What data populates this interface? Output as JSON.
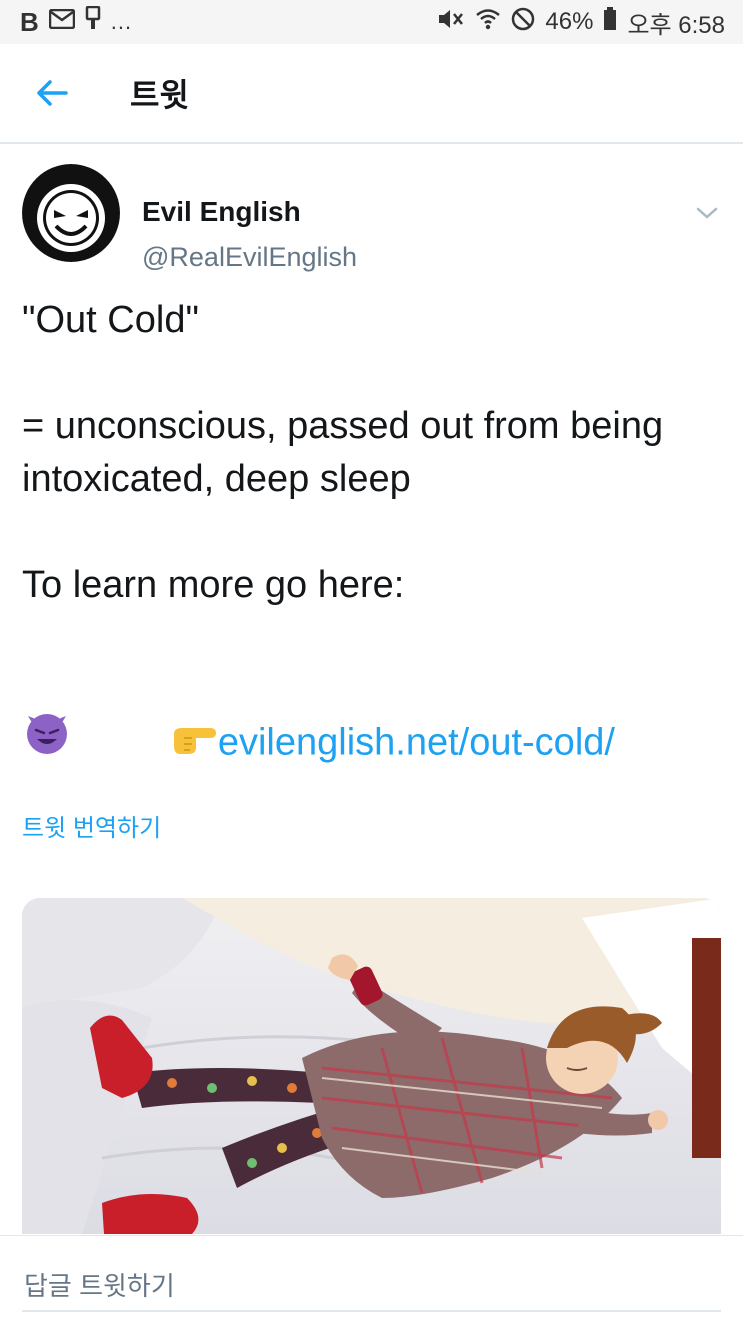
{
  "status_bar": {
    "left_letter": "B",
    "ellipsis": "...",
    "battery": "46%",
    "time": "오후 6:58"
  },
  "header": {
    "title": "트윗"
  },
  "tweet": {
    "author_name": "Evil English",
    "author_handle": "@RealEvilEnglish",
    "text_line1": "\"Out Cold\"",
    "text_line2": "= unconscious, passed out from being",
    "text_line3": "intoxicated, deep sleep",
    "text_line4": "To learn more go here:",
    "link_text": "evilenglish.net/out-cold/",
    "translate_label": "트윗 번역하기"
  },
  "reply": {
    "placeholder": "답글 트윗하기"
  },
  "colors": {
    "accent": "#1da1f2",
    "text": "#14171a",
    "muted": "#657786",
    "divider": "#e1e8ed",
    "devil_purple": "#7f5ab8"
  },
  "icons": [
    "back-arrow-icon",
    "chevron-down-icon",
    "mail-icon",
    "mute-icon",
    "wifi-icon",
    "no-disturb-icon",
    "battery-icon",
    "pointing-hand-emoji",
    "smiling-devil-emoji"
  ]
}
